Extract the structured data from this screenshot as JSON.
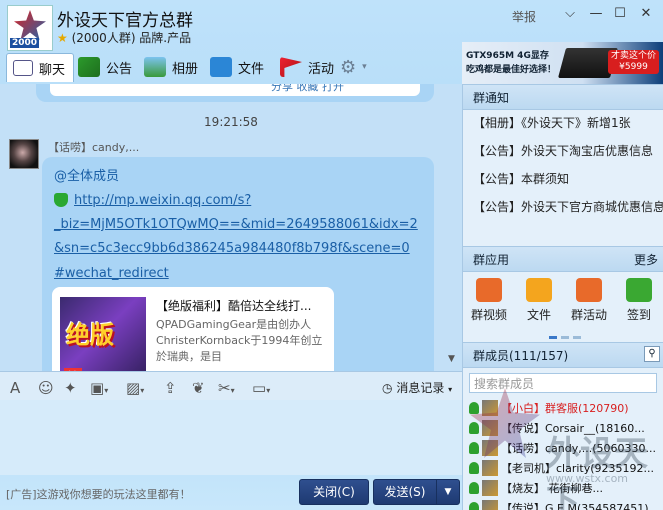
{
  "header": {
    "group_name": "外设天下官方总群",
    "badge": "2000",
    "star": "★",
    "info": "(2000人群) 品牌.产品",
    "report": "举报",
    "win_controls": [
      "⌵",
      "—",
      "☐",
      "✕"
    ]
  },
  "tabs": [
    {
      "label": "聊天"
    },
    {
      "label": "公告"
    },
    {
      "label": "相册"
    },
    {
      "label": "文件"
    },
    {
      "label": "活动"
    }
  ],
  "banner": {
    "line1": "GTX965M 4G显存",
    "line2": "吃鸡都是最佳好选择！",
    "price_line1": "才卖这个价",
    "price_line2": "¥5999"
  },
  "chat": {
    "prev_links": "分享  收藏  打开",
    "time": "19:21:58",
    "sender": "【话唠】candy,...",
    "msg_lines": [
      "@全体成员",
      "http://mp.weixin.qq.com/s?",
      "_biz=MjM5OTk1OTQwMQ==&mid=2649588061&idx=2",
      "&sn=c5c3ecc9bb6d386245a984480f8b798f&scene=0",
      "#wechat_redirect"
    ],
    "card": {
      "img_text": "绝版",
      "img_tag": "抢",
      "title": "【绝版福利】酷倍达全线打...",
      "desc": "QPADGamingGear是由创办人ChristerKornback于1994年创立於瑞典，是目"
    }
  },
  "toolbar": {
    "history": "消息记录"
  },
  "bottom": {
    "ad": "[广告]这游戏你想要的玩法这里都有！",
    "close": "关闭(C)",
    "send": "发送(S)"
  },
  "right": {
    "notice_title": "群通知",
    "notices": [
      "【相册】《外设天下》新增1张",
      "【公告】外设天下淘宝店优惠信息",
      "【公告】本群须知",
      "【公告】外设天下官方商城优惠信息"
    ],
    "apps_title": "群应用",
    "more": "更多",
    "apps": [
      {
        "label": "群视频"
      },
      {
        "label": "文件"
      },
      {
        "label": "群活动"
      },
      {
        "label": "签到"
      }
    ],
    "members_title": "群成员(111/157)",
    "search_placeholder": "搜索群成员",
    "members": [
      {
        "text": "【小白】群客服(120790)",
        "color": "#d82020"
      },
      {
        "text": "【传说】Corsair__(18160...",
        "color": "#111"
      },
      {
        "text": "【话唠】candy,...(5060330...",
        "color": "#111"
      },
      {
        "text": "【老司机】clarity(9235192...",
        "color": "#111"
      },
      {
        "text": "【烧友】 花街柳巷...",
        "color": "#111"
      },
      {
        "text": "【传说】G.E.M(354587451)",
        "color": "#111"
      }
    ],
    "watermark": "外设天下",
    "watermark_url": "www.wstx.com"
  }
}
